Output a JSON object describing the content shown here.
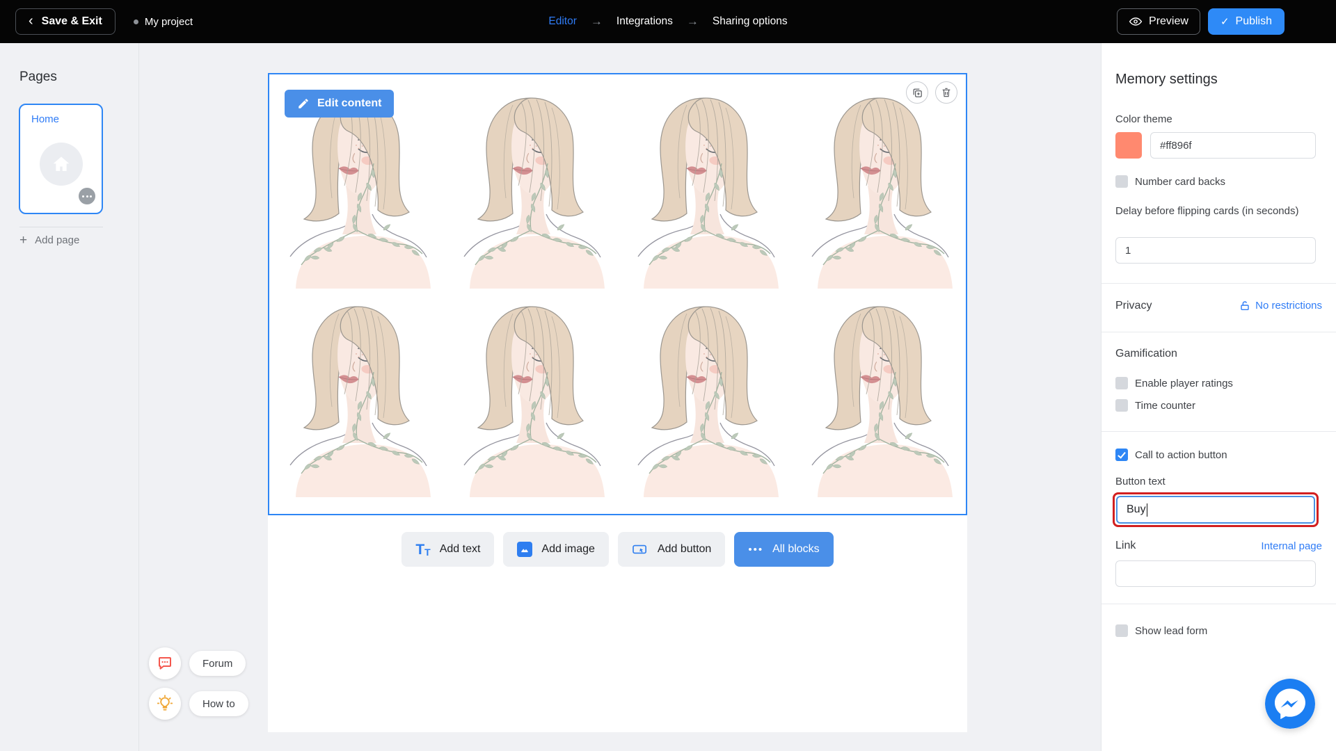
{
  "colors": {
    "accent_blue": "#2f7cf6",
    "publish_blue": "#2e8af7",
    "button_blue": "#4a8fe8",
    "card_border_blue": "#2e86f5",
    "color_theme_swatch": "#ff896f",
    "error_red": "#d21f1f",
    "forum_icon_red": "#f4574d",
    "howto_icon_yellow": "#f0a93a",
    "messenger_blue": "#1b7ef2"
  },
  "topbar": {
    "save_exit_label": "Save & Exit",
    "project_name": "My project",
    "nav": [
      {
        "label": "Editor",
        "active": true
      },
      {
        "label": "Integrations",
        "active": false
      },
      {
        "label": "Sharing options",
        "active": false
      }
    ],
    "preview_label": "Preview",
    "publish_label": "Publish"
  },
  "sidebar": {
    "pages_title": "Pages",
    "page_card": {
      "name": "Home"
    },
    "add_page_label": "Add page"
  },
  "canvas": {
    "edit_content_label": "Edit content",
    "cards_count": 8,
    "toolbar": [
      {
        "label": "Add text",
        "icon": "text-icon"
      },
      {
        "label": "Add image",
        "icon": "image-icon"
      },
      {
        "label": "Add button",
        "icon": "button-icon"
      },
      {
        "label": "All blocks",
        "icon": "blocks-icon",
        "primary": true
      }
    ]
  },
  "help": {
    "forum_label": "Forum",
    "howto_label": "How to"
  },
  "settings_panel": {
    "title": "Memory settings",
    "color_theme": {
      "label": "Color theme",
      "value": "#ff896f"
    },
    "number_card_backs": {
      "label": "Number card backs",
      "checked": false
    },
    "delay": {
      "label": "Delay before flipping cards (in seconds)",
      "value": "1"
    },
    "privacy": {
      "label": "Privacy",
      "link": "No restrictions"
    },
    "gamification": {
      "title": "Gamification",
      "options": [
        {
          "label": "Enable player ratings",
          "checked": false
        },
        {
          "label": "Time counter",
          "checked": false
        }
      ]
    },
    "cta": {
      "label": "Call to action button",
      "checked": true,
      "button_text_label": "Button text",
      "button_text_value": "Buy",
      "link_label": "Link",
      "link_action": "Internal page",
      "link_value": ""
    },
    "show_lead_form": {
      "label": "Show lead form",
      "checked": false
    }
  }
}
